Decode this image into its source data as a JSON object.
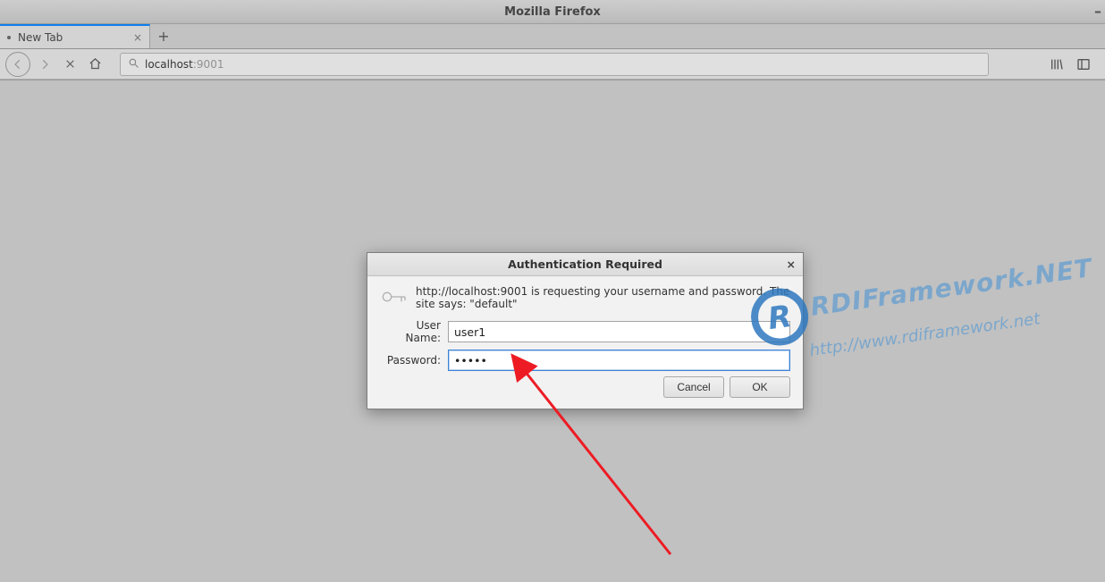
{
  "window": {
    "title": "Mozilla Firefox",
    "minimize_glyph": "–"
  },
  "tab": {
    "label": "New Tab",
    "close_glyph": "×",
    "new_tab_glyph": "+"
  },
  "urlbar": {
    "host": "localhost",
    "port": ":9001"
  },
  "dialog": {
    "title": "Authentication Required",
    "close_glyph": "×",
    "message": "http://localhost:9001 is requesting your username and password. The site says: \"default\"",
    "username_label": "User Name:",
    "password_label": "Password:",
    "username_value": "user1",
    "password_value": "•••••",
    "cancel_label": "Cancel",
    "ok_label": "OK"
  },
  "watermark": {
    "brand": "RDIFramework.NET",
    "url": "http://www.rdiframework.net"
  }
}
